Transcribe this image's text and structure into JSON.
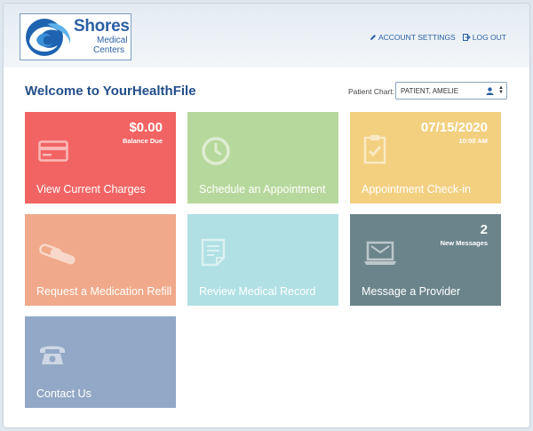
{
  "brand": {
    "name": "Shores",
    "sub_line_1": "Medical",
    "sub_line_2": "Centers"
  },
  "top_links": {
    "account_settings": "ACCOUNT SETTINGS",
    "log_out": "LOG OUT"
  },
  "welcome": "Welcome to YourHealthFile",
  "patient_chart": {
    "label": "Patient Chart:",
    "selected": "PATIENT, AMELIE"
  },
  "tiles": [
    {
      "label": "View Current Charges",
      "value": "$0.00",
      "sub": "Balance Due",
      "color": "#f26464",
      "icon": "credit-card-icon"
    },
    {
      "label": "Schedule an Appointment",
      "color": "#b7d89c",
      "icon": "clock-icon"
    },
    {
      "label": "Appointment Check-in",
      "value": "07/15/2020",
      "sub": "10:00 AM",
      "color": "#f2d080",
      "icon": "clipboard-check-icon"
    },
    {
      "label": "Request a Medication Refill",
      "color": "#f0a98a",
      "icon": "pills-icon"
    },
    {
      "label": "Review Medical Record",
      "color": "#b0e0e4",
      "icon": "document-icon"
    },
    {
      "label": "Message a Provider",
      "value": "2",
      "sub": "New Messages",
      "color": "#6b848c",
      "icon": "laptop-mail-icon"
    },
    {
      "label": "Contact Us",
      "color": "#93a8c6",
      "icon": "telephone-icon"
    }
  ]
}
